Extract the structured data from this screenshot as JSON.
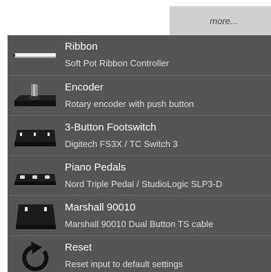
{
  "more_button": {
    "label": "more..."
  },
  "menu": {
    "items": [
      {
        "title": "Ribbon",
        "subtitle": "Soft Pot Ribbon Controller",
        "icon": "ribbon-controller-icon"
      },
      {
        "title": "Encoder",
        "subtitle": "Rotary encoder with push button",
        "icon": "rotary-encoder-icon"
      },
      {
        "title": "3-Button Footswitch",
        "subtitle": "Digitech FS3X / TC Switch 3",
        "icon": "footswitch-3-button-icon"
      },
      {
        "title": "Piano Pedals",
        "subtitle": "Nord Triple Pedal / StudioLogic SLP3-D",
        "icon": "piano-pedals-icon"
      },
      {
        "title": "Marshall 90010",
        "subtitle": "Marshall 90010 Dual Button TS cable",
        "icon": "footswitch-2-button-icon"
      },
      {
        "title": "Reset",
        "subtitle": "Reset input to default settings",
        "icon": "reset-icon"
      }
    ]
  },
  "colors": {
    "menu_bg": "#555555",
    "divider": "#6b6b6b",
    "title_text": "#ffffff",
    "subtitle_text": "#dddddd",
    "more_bg": "#cfcfcf"
  }
}
